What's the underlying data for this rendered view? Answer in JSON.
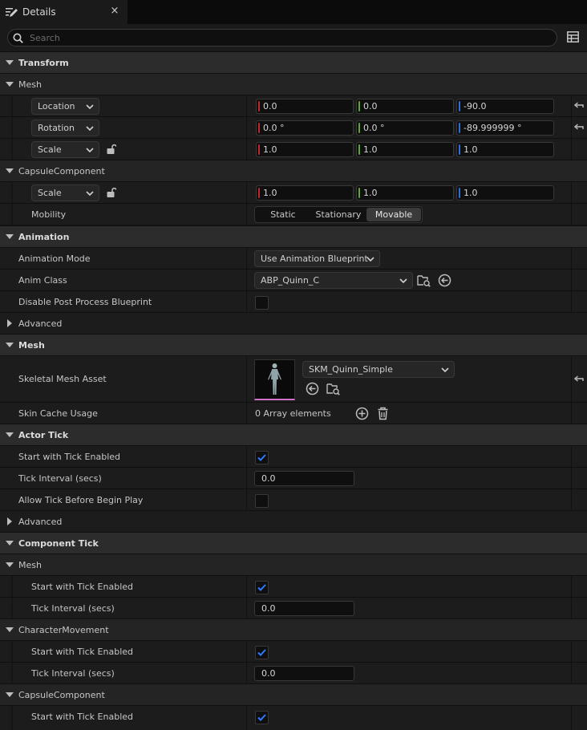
{
  "tab": {
    "title": "Details",
    "close": "×"
  },
  "search": {
    "placeholder": "Search",
    "value": ""
  },
  "rows": {
    "transform": "Transform",
    "mesh_sub": "Mesh",
    "location": "Location",
    "rotation": "Rotation",
    "scale": "Scale",
    "capsule_sub": "CapsuleComponent",
    "capsule_scale": "Scale",
    "mobility": "Mobility",
    "animation": "Animation",
    "anim_mode": "Animation Mode",
    "anim_class": "Anim Class",
    "disable_pp": "Disable Post Process Blueprint",
    "advanced1": "Advanced",
    "mesh_cat": "Mesh",
    "skel_mesh": "Skeletal Mesh Asset",
    "skin_cache": "Skin Cache Usage",
    "actor_tick": "Actor Tick",
    "start_tick": "Start with Tick Enabled",
    "tick_interval": "Tick Interval (secs)",
    "allow_tick": "Allow Tick Before Begin Play",
    "advanced2": "Advanced",
    "component_tick": "Component Tick",
    "ct_mesh": "Mesh",
    "ct_mesh_start": "Start with Tick Enabled",
    "ct_mesh_interval": "Tick Interval (secs)",
    "ct_charmove": "CharacterMovement",
    "ct_cm_start": "Start with Tick Enabled",
    "ct_cm_interval": "Tick Interval (secs)",
    "ct_capsule": "CapsuleComponent",
    "ct_cap_start": "Start with Tick Enabled"
  },
  "values": {
    "location": [
      "0.0",
      "0.0",
      "-90.0"
    ],
    "rotation": [
      "0.0 °",
      "0.0 °",
      "-89.999999 °"
    ],
    "scale": [
      "1.0",
      "1.0",
      "1.0"
    ],
    "capsule_scale": [
      "1.0",
      "1.0",
      "1.0"
    ],
    "mobility_options": [
      "Static",
      "Stationary",
      "Movable"
    ],
    "mobility_selected": "Movable",
    "anim_mode": "Use Animation Blueprint",
    "anim_class": "ABP_Quinn_C",
    "disable_pp": false,
    "skel_mesh": "SKM_Quinn_Simple",
    "skin_cache": "0 Array elements",
    "start_tick": true,
    "tick_interval": "0.0",
    "allow_tick": false,
    "ct_mesh_start": true,
    "ct_mesh_interval": "0.0",
    "ct_cm_start": true,
    "ct_cm_interval": "0.0",
    "ct_cap_start": true
  },
  "colors": {
    "axis_x": "#c0282b",
    "axis_y": "#5ea82c",
    "axis_z": "#2f6fd6",
    "check": "#2b7cff",
    "thumb_accent": "#d072c8"
  },
  "icons": {
    "tab": "details-pencil-icon",
    "search": "search-icon",
    "view_options": "view-options-icon",
    "reset": "reset-to-default-icon",
    "lock": "unlocked-icon",
    "browse": "browse-asset-icon",
    "use_selected": "use-selected-icon",
    "add": "add-element-icon",
    "delete": "delete-elements-icon"
  }
}
